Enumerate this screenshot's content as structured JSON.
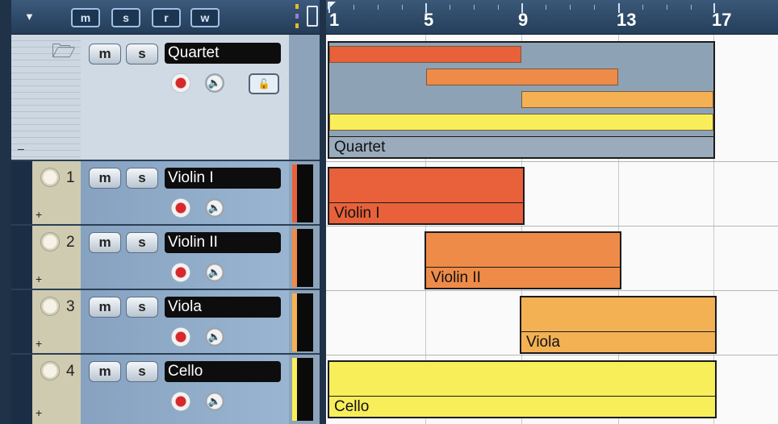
{
  "header": {
    "buttons": [
      "m",
      "s",
      "r",
      "w"
    ]
  },
  "ruler": {
    "marks": [
      "1",
      "5",
      "9",
      "13",
      "17"
    ]
  },
  "folder": {
    "name": "Quartet",
    "mute": "m",
    "solo": "s",
    "collapse": "–"
  },
  "tracks": [
    {
      "number": "1",
      "name": "Violin I",
      "color": "#e8613a",
      "mute": "m",
      "solo": "s",
      "expand": "+"
    },
    {
      "number": "2",
      "name": "Violin II",
      "color": "#ef8b48",
      "mute": "m",
      "solo": "s",
      "expand": "+"
    },
    {
      "number": "3",
      "name": "Viola",
      "color": "#f3b154",
      "mute": "m",
      "solo": "s",
      "expand": "+"
    },
    {
      "number": "4",
      "name": "Cello",
      "color": "#f8ee5a",
      "mute": "m",
      "solo": "s",
      "expand": "+"
    }
  ],
  "parts": {
    "folder_label": "Quartet",
    "violin1": "Violin I",
    "violin2": "Violin II",
    "viola": "Viola",
    "cello": "Cello"
  },
  "icons": [
    "folder-open-icon",
    "record-icon",
    "speaker-icon",
    "lock-icon",
    "knob-icon",
    "window-icon",
    "menu-arrow-icon"
  ]
}
